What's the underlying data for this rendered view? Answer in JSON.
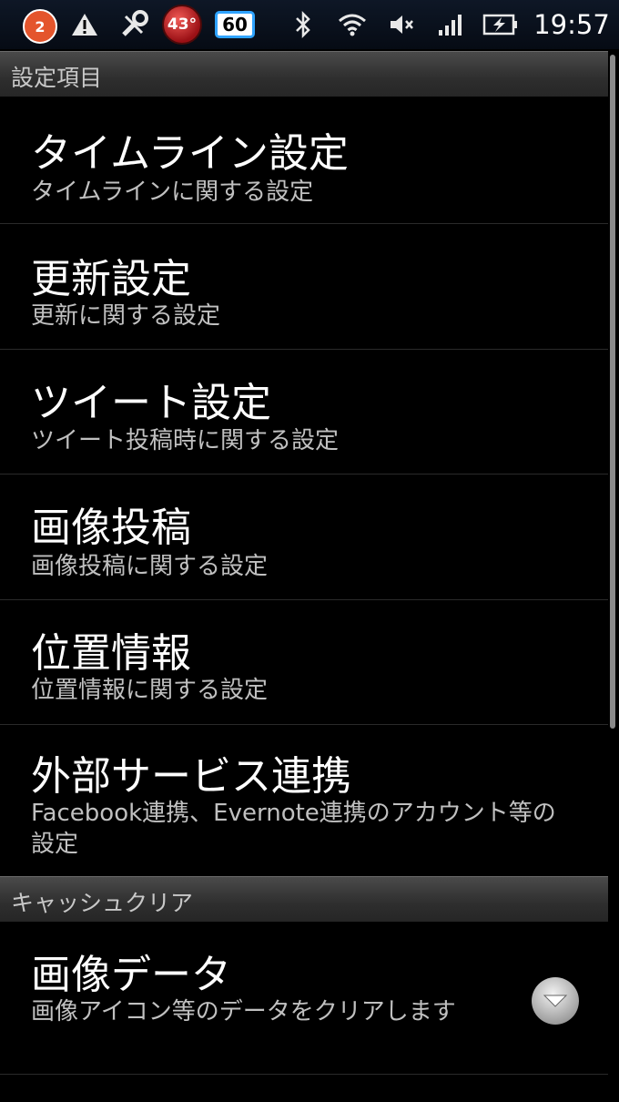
{
  "status_bar": {
    "notification_count": "2",
    "temperature": "43°",
    "battery_level": "60",
    "time": "19:57"
  },
  "sections": [
    {
      "header": "設定項目",
      "items": [
        {
          "title": "タイムライン設定",
          "summary": "タイムラインに関する設定"
        },
        {
          "title": "更新設定",
          "summary": "更新に関する設定"
        },
        {
          "title": "ツイート設定",
          "summary": "ツイート投稿時に関する設定"
        },
        {
          "title": "画像投稿",
          "summary": "画像投稿に関する設定"
        },
        {
          "title": "位置情報",
          "summary": "位置情報に関する設定"
        },
        {
          "title": "外部サービス連携",
          "summary": "Facebook連携、Evernote連携のアカウント等の設定"
        }
      ]
    },
    {
      "header": "キャッシュクリア",
      "items": [
        {
          "title": "画像データ",
          "summary": "画像アイコン等のデータをクリアします"
        }
      ]
    }
  ]
}
